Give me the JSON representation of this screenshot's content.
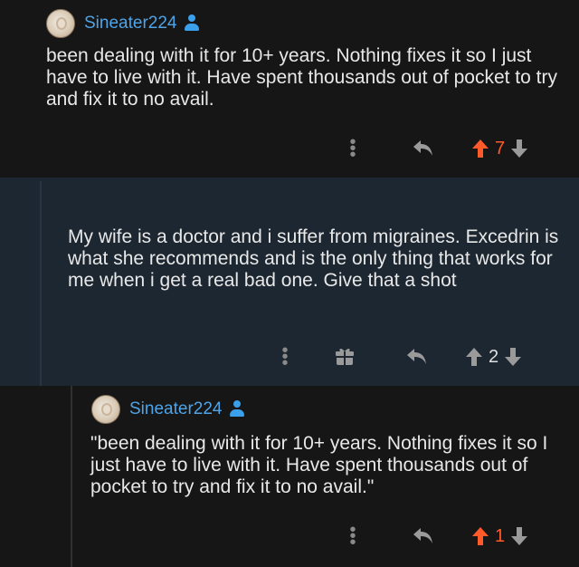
{
  "comments": [
    {
      "username": "Sineater224",
      "text": "been dealing with it for 10+ years. Nothing fixes it so I just have to live with it. Have spent thousands out of pocket to try and fix it to no avail.",
      "score": "7",
      "vote_color": "#ff5a2a"
    },
    {
      "text": "My wife is a doctor and i suffer from migraines. Excedrin is what she recommends and is the only thing that works for me when i get a real bad one. Give that a shot",
      "score": "2"
    },
    {
      "username": "Sineater224",
      "text": "\"been dealing with it for 10+ years. Nothing fixes it so I just have to live with it. Have spent thousands out of pocket to try and fix it to no avail.\"",
      "score": "1",
      "vote_color": "#ff5a2a"
    }
  ],
  "colors": {
    "username": "#4ea4e8",
    "user_icon": "#3aa0ec",
    "highlight_bg": "#1d2731",
    "icon_gray": "#8a8a8a"
  }
}
